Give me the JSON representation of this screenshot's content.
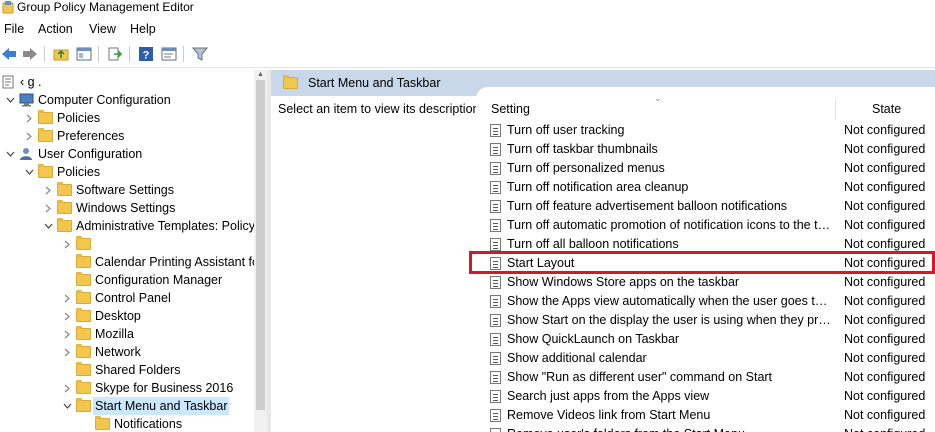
{
  "window": {
    "title": "Group Policy Management Editor"
  },
  "menu": [
    "File",
    "Action",
    "View",
    "Help"
  ],
  "toolbar": {
    "icons": [
      "back-arrow-icon",
      "forward-arrow-icon",
      "up-folder-icon",
      "show-hide-tree-icon",
      "export-list-icon",
      "help-icon",
      "properties-icon",
      "filter-icon"
    ]
  },
  "tree": {
    "root": "‹                    g .",
    "items": [
      {
        "label": "Computer Configuration",
        "level": 0,
        "expanded": true
      },
      {
        "label": "Policies",
        "level": 1,
        "expanded": false
      },
      {
        "label": "Preferences",
        "level": 1,
        "expanded": false
      },
      {
        "label": "User Configuration",
        "level": 0,
        "expanded": true
      },
      {
        "label": "Policies",
        "level": 1,
        "expanded": true
      },
      {
        "label": "Software Settings",
        "level": 2,
        "expanded": false
      },
      {
        "label": "Windows Settings",
        "level": 2,
        "expanded": false
      },
      {
        "label": "Administrative Templates: Policy",
        "level": 2,
        "expanded": true
      },
      {
        "label": "",
        "level": 3,
        "expanded": false
      },
      {
        "label": "Calendar Printing Assistant fo",
        "level": 3,
        "expanded": null
      },
      {
        "label": "Configuration Manager",
        "level": 3,
        "expanded": null
      },
      {
        "label": "Control Panel",
        "level": 3,
        "expanded": false
      },
      {
        "label": "Desktop",
        "level": 3,
        "expanded": false
      },
      {
        "label": "Mozilla",
        "level": 3,
        "expanded": false
      },
      {
        "label": "Network",
        "level": 3,
        "expanded": false
      },
      {
        "label": "Shared Folders",
        "level": 3,
        "expanded": null
      },
      {
        "label": "Skype for Business 2016",
        "level": 3,
        "expanded": false
      },
      {
        "label": "Start Menu and Taskbar",
        "level": 3,
        "expanded": true,
        "selected": true
      },
      {
        "label": "Notifications",
        "level": 4,
        "expanded": null
      }
    ]
  },
  "details": {
    "header": "Start Menu and Taskbar",
    "description": "Select an item to view its description.",
    "columns": {
      "setting": "Setting",
      "state": "State"
    },
    "rows": [
      {
        "setting": "Turn off user tracking",
        "state": "Not configured"
      },
      {
        "setting": "Turn off taskbar thumbnails",
        "state": "Not configured"
      },
      {
        "setting": "Turn off personalized menus",
        "state": "Not configured"
      },
      {
        "setting": "Turn off notification area cleanup",
        "state": "Not configured"
      },
      {
        "setting": "Turn off feature advertisement balloon notifications",
        "state": "Not configured"
      },
      {
        "setting": "Turn off automatic promotion of notification icons to the taskbar",
        "state": "Not configured"
      },
      {
        "setting": "Turn off all balloon notifications",
        "state": "Not configured"
      },
      {
        "setting": "Start Layout",
        "state": "Not configured",
        "highlighted": true
      },
      {
        "setting": "Show Windows Store apps on the taskbar",
        "state": "Not configured"
      },
      {
        "setting": "Show the Apps view automatically when the user goes to Start",
        "state": "Not configured"
      },
      {
        "setting": "Show Start on the display the user is using when they press the Windows logo key",
        "state": "Not configured"
      },
      {
        "setting": "Show QuickLaunch on Taskbar",
        "state": "Not configured"
      },
      {
        "setting": "Show additional calendar",
        "state": "Not configured"
      },
      {
        "setting": "Show \"Run as different user\" command on Start",
        "state": "Not configured"
      },
      {
        "setting": "Search just apps from the Apps view",
        "state": "Not configured"
      },
      {
        "setting": "Remove Videos link from Start Menu",
        "state": "Not configured"
      },
      {
        "setting": "Remove user's folders from the Start Menu",
        "state": "Not configured"
      }
    ]
  },
  "colors": {
    "highlight": "#d01a2a",
    "header": "#c8d8ea",
    "selection": "#cce8ff"
  }
}
